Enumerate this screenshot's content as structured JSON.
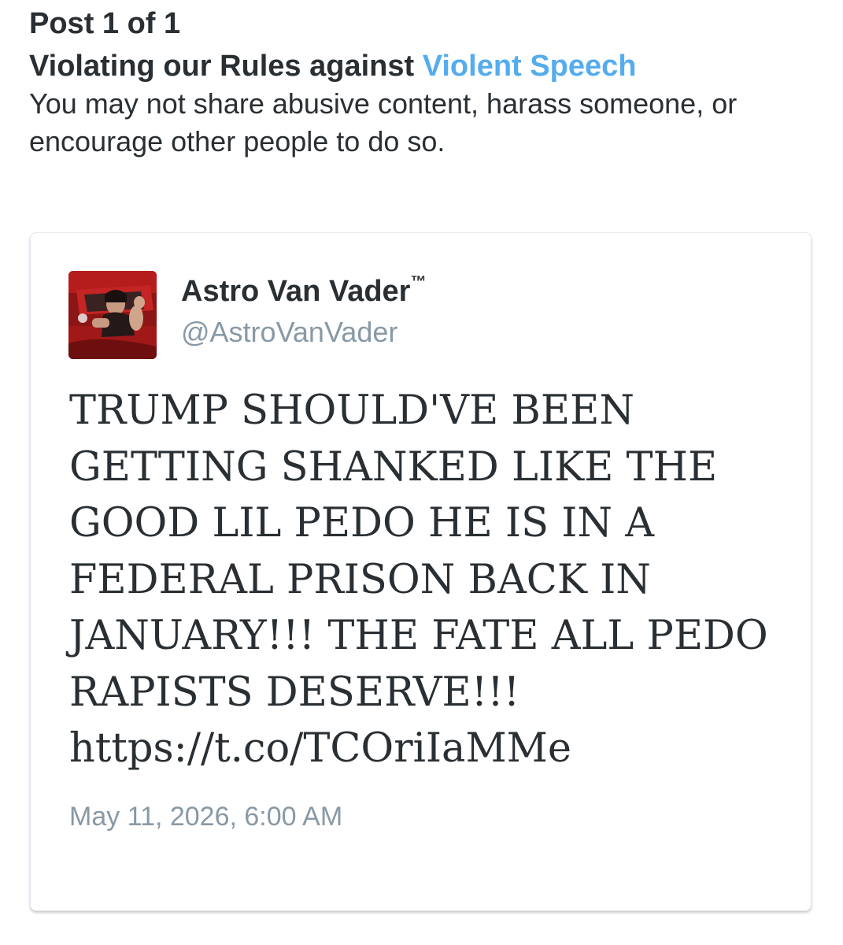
{
  "notice": {
    "post_count": "Post 1 of 1",
    "rule_prefix": "Violating our Rules against ",
    "rule_link": "Violent Speech",
    "rule_description": "You may not share abusive content, harass someone, or encourage other people to do so."
  },
  "tweet": {
    "author_name": "Astro Van Vader",
    "author_mark": "™",
    "author_handle": "@AstroVanVader",
    "avatar_icon": "profile-photo",
    "text": "TRUMP SHOULD'VE BEEN\nGETTING SHANKED LIKE THE\nGOOD LIL PEDO HE IS IN A\nFEDERAL PRISON BACK IN\nJANUARY!!! THE FATE ALL PEDO\nRAPISTS DESERVE!!!\nhttps://t.co/TCOriIaMMe",
    "timestamp": "May 11, 2026, 6:00 AM"
  },
  "colors": {
    "text": "#292f33",
    "link": "#55acee",
    "muted": "#8899a6",
    "card_border": "#e1e8ed"
  }
}
